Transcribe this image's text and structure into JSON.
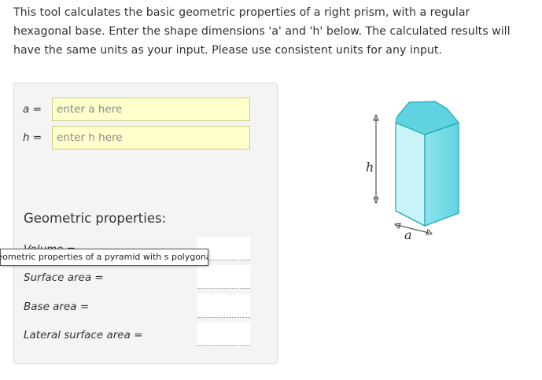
{
  "intro": {
    "text": "This tool calculates the basic geometric properties of a right prism, with a regular hexagonal base. Enter the shape dimensions 'a' and 'h' below. The calculated results will have the same units as your input. Please use consistent units for any input."
  },
  "inputs": [
    {
      "label": "a =",
      "placeholder": "enter a here",
      "value": ""
    },
    {
      "label": "h =",
      "placeholder": "enter h here",
      "value": ""
    }
  ],
  "results": {
    "heading": "Geometric properties:",
    "rows": [
      {
        "label": "Volume =",
        "value": ""
      },
      {
        "label": "Surface area =",
        "value": ""
      },
      {
        "label": "Base area =",
        "value": ""
      },
      {
        "label": "Lateral surface area =",
        "value": ""
      }
    ]
  },
  "tooltip": {
    "text": "Geometric properties of a pyramid with s polygonal base."
  },
  "diagram": {
    "height_label": "h",
    "side_label": "a",
    "fill_color": "#5fd3e0",
    "edge_color": "#1aa7b5"
  }
}
